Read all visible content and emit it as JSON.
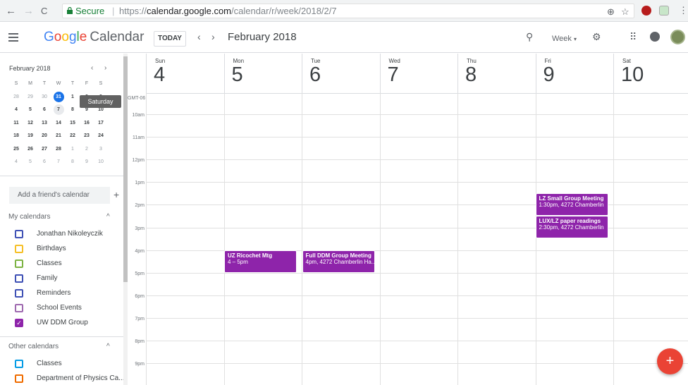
{
  "browser": {
    "back": "←",
    "forward": "→",
    "reload": "C",
    "secure_label": "Secure",
    "url_scheme": "https://",
    "url_host": "calendar.google.com",
    "url_path": "/calendar/r/week/2018/2/7",
    "zoom_icon": "⊕",
    "star_icon": "☆",
    "menu_icon": "⋮"
  },
  "header": {
    "logo_letters": [
      "G",
      "o",
      "o",
      "g",
      "l",
      "e"
    ],
    "app_name": "Calendar",
    "today_label": "TODAY",
    "prev_icon": "‹",
    "next_icon": "›",
    "range_title": "February 2018",
    "search_icon": "⚲",
    "view_label": "Week",
    "view_caret": "▾",
    "settings_icon": "⚙",
    "apps_icon": "⠿"
  },
  "mini_calendar": {
    "title": "February 2018",
    "prev_icon": "‹",
    "next_icon": "›",
    "weekday_heads": [
      "S",
      "M",
      "T",
      "W",
      "T",
      "F",
      "S"
    ],
    "weeks": [
      [
        "28",
        "29",
        "30",
        "31",
        "1",
        "2",
        "3"
      ],
      [
        "4",
        "5",
        "6",
        "7",
        "8",
        "9",
        "10"
      ],
      [
        "11",
        "12",
        "13",
        "14",
        "15",
        "16",
        "17"
      ],
      [
        "18",
        "19",
        "20",
        "21",
        "22",
        "23",
        "24"
      ],
      [
        "25",
        "26",
        "27",
        "28",
        "1",
        "2",
        "3"
      ],
      [
        "4",
        "5",
        "6",
        "7",
        "8",
        "9",
        "10"
      ]
    ],
    "tooltip": "Saturday"
  },
  "sidebar": {
    "friend_placeholder": "Add a friend's calendar",
    "friend_plus": "+",
    "my_calendars_title": "My calendars",
    "my_calendars_chevron": "^",
    "my_calendars": [
      {
        "label": "Jonathan Nikoleyczik",
        "color": "#3f51b5",
        "checked": false
      },
      {
        "label": "Birthdays",
        "color": "#f6bf26",
        "checked": false
      },
      {
        "label": "Classes",
        "color": "#7cb342",
        "checked": false
      },
      {
        "label": "Family",
        "color": "#3f51b5",
        "checked": false
      },
      {
        "label": "Reminders",
        "color": "#3f51b5",
        "checked": false
      },
      {
        "label": "School Events",
        "color": "#9e69af",
        "checked": false
      },
      {
        "label": "UW DDM Group",
        "color": "#8e24aa",
        "checked": true
      }
    ],
    "other_calendars_title": "Other calendars",
    "other_calendars_chevron": "^",
    "other_calendars": [
      {
        "label": "Classes",
        "color": "#039be5",
        "checked": false
      },
      {
        "label": "Department of Physics Ca...",
        "color": "#ef6c00",
        "checked": false
      }
    ]
  },
  "week": {
    "timezone": "GMT-06",
    "days": [
      {
        "dow": "Sun",
        "num": "4"
      },
      {
        "dow": "Mon",
        "num": "5"
      },
      {
        "dow": "Tue",
        "num": "6"
      },
      {
        "dow": "Wed",
        "num": "7"
      },
      {
        "dow": "Thu",
        "num": "8"
      },
      {
        "dow": "Fri",
        "num": "9"
      },
      {
        "dow": "Sat",
        "num": "10"
      }
    ],
    "hours": [
      "10am",
      "11am",
      "12pm",
      "1pm",
      "2pm",
      "3pm",
      "4pm",
      "5pm",
      "6pm",
      "7pm",
      "8pm",
      "9pm"
    ],
    "events": [
      {
        "title": "UZ Ricochet Mtg",
        "time": "4 – 5pm",
        "color": "#8e24aa"
      },
      {
        "title": "Full DDM Group Meeting",
        "time": "4pm, 4272 Chamberlin Ha...",
        "color": "#8e24aa"
      },
      {
        "title": "LZ Small Group Meeting",
        "time": "1:30pm, 4272 Chamberlin",
        "color": "#8e24aa"
      },
      {
        "title": "LUX/LZ paper readings",
        "time": "2:30pm, 4272 Chamberlin",
        "color": "#8e24aa"
      }
    ]
  },
  "fab_label": "+"
}
